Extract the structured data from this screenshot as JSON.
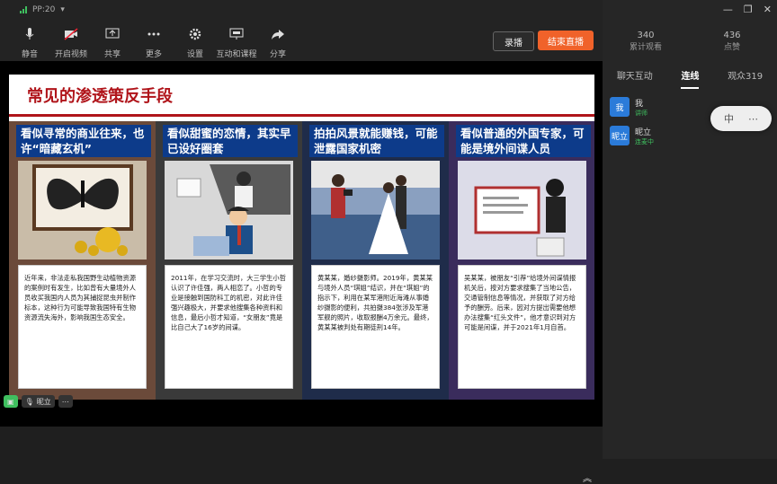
{
  "status": {
    "text": "PP:20"
  },
  "toolbar": [
    {
      "name": "mute-button",
      "icon": "microphone-icon",
      "label": "静音"
    },
    {
      "name": "video-button",
      "icon": "camera-off-icon",
      "label": "开启视频"
    },
    {
      "name": "share-button",
      "icon": "share-screen-icon",
      "label": "共享"
    },
    {
      "name": "more-button",
      "icon": "ellipsis-icon",
      "label": "更多"
    },
    {
      "name": "settings-button",
      "icon": "gear-icon",
      "label": "设置"
    },
    {
      "name": "interaction-button",
      "icon": "interact-icon",
      "label": "互动和课程"
    },
    {
      "name": "forward-button",
      "icon": "arrow-share-icon",
      "label": "分享"
    }
  ],
  "record_label": "录播",
  "end_label": "结束直播",
  "stats": [
    {
      "num": "340",
      "label": "累计观看"
    },
    {
      "num": "436",
      "label": "点赞"
    }
  ],
  "tabs": [
    "聊天互动",
    "连线",
    "观众319"
  ],
  "members": [
    {
      "avatar": "我",
      "name": "我",
      "tag": "讲师"
    },
    {
      "avatar": "昵立",
      "name": "昵立",
      "tag": "连麦中"
    }
  ],
  "ime": "中",
  "slide": {
    "title": "常见的渗透策反手段",
    "panels": [
      {
        "caption": "看似寻常的商业往来，也许“暗藏玄机”",
        "color": "#6b4a3a",
        "text": "近年来，非法走私我国野生动植物资源的案例时有发生，比如曾有大量境外人员收买我国内人员为其捕捉昆虫并制作标本，这种行为可能导致我国特有生物资源流失海外，影响我国生态安全。"
      },
      {
        "caption": "看似甜蜜的恋情，其实早已设好圈套",
        "color": "#3a3a3a",
        "text": "2011年，在学习交流时，大三学生小哲认识了许佳强，两人相恋了。小哲的专业是接触到国防科工的机密，对此许佳强兴趣极大，并要求他搜集各种资料和信息，最后小哲才知道，“女朋友”竟是比自己大了16岁的间谍。"
      },
      {
        "caption": "拍拍风景就能赚钱，可能泄露国家机密",
        "color": "#1f2c4a",
        "text": "黄某某，婚纱摄影师。2019年，黄某某与境外人员“琪姐”结识，并在“琪姐”的指示下，利用在某军港附近海滩从事婚纱摄影的便利，共拍摄384张涉及军港军舰的照片，收取报酬4万余元。最终，黄某某被判处有期徒刑14年。"
      },
      {
        "caption": "看似普通的外国专家，可能是境外间谍人员",
        "color": "#3a2c5c",
        "text": "吴某某，被朋友“引荐”给境外间谍情报机关后，按对方要求搜集了当地公告，交通管制信息等情况，并获取了对方给予的酬劳。后来，因对方提出需要他想办法搜集“红头文件”，他才意识到对方可能是间谍，并于2021年1月自首。"
      }
    ]
  },
  "bottom": {
    "cam_label": "",
    "name_label": "昵立"
  },
  "colors": {
    "accent": "#f0622a",
    "title_red": "#b0141a",
    "caption_blue": "#0d3b8a"
  }
}
